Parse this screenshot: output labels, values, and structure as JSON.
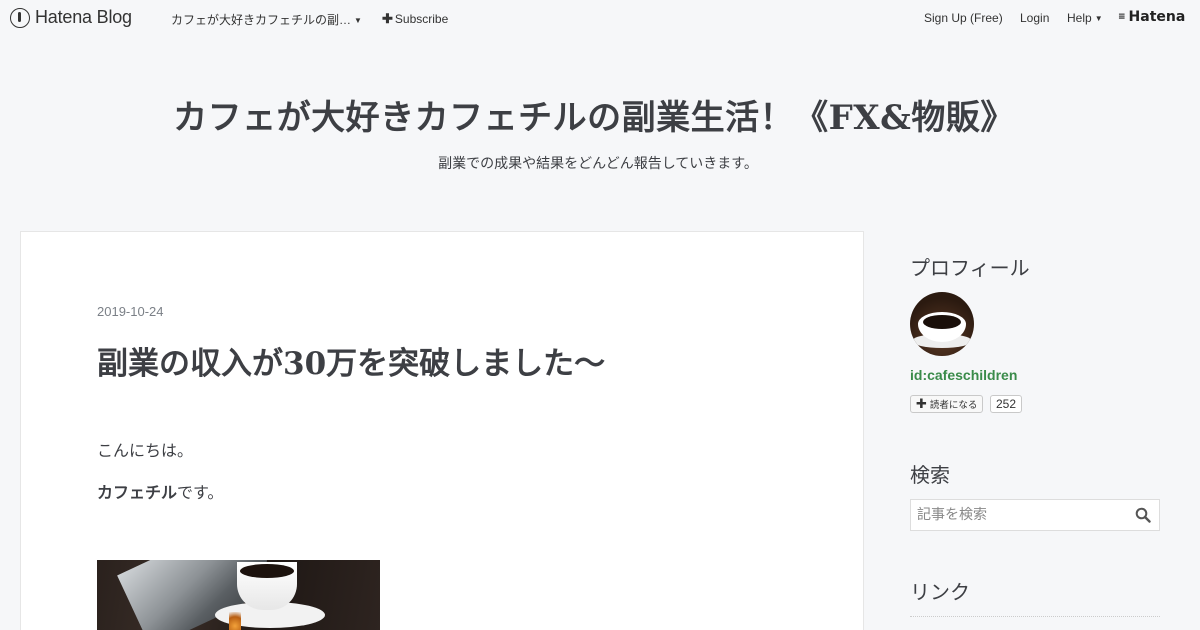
{
  "topbar": {
    "logo_text": "Hatena Blog",
    "blog_menu_label": "カフェが大好きカフェチルの副…",
    "subscribe_label": "Subscribe",
    "signup_label": "Sign Up (Free)",
    "login_label": "Login",
    "help_label": "Help",
    "brand_label": "Hatena"
  },
  "header": {
    "title": "カフェが大好きカフェチルの副業生活！《FX&物販》",
    "description": "副業での成果や結果をどんどん報告していきます。"
  },
  "article": {
    "date": "2019-10-24",
    "title": "副業の収入が30万を突破しました〜",
    "paragraph1": "こんにちは。",
    "paragraph2_bold": "カフェチル",
    "paragraph2_rest": "です。"
  },
  "sidebar": {
    "profile_heading": "プロフィール",
    "user_id": "id:cafeschildren",
    "follow_label": "読者になる",
    "follow_count": "252",
    "search_heading": "検索",
    "search_placeholder": "記事を検索",
    "links_heading": "リンク"
  },
  "colors": {
    "background": "#f6f7f9",
    "text": "#3d3f44",
    "user_id": "#3a8b4a"
  }
}
